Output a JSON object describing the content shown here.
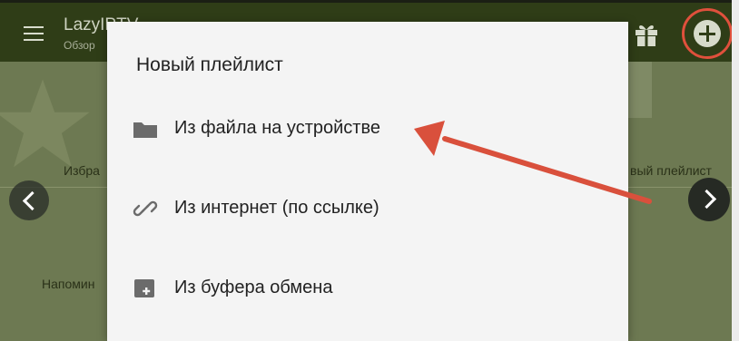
{
  "app_bar": {
    "title": "LazyIPTV",
    "subtitle": "Обзор",
    "add_button_label": "+"
  },
  "background": {
    "tiles": [
      {
        "label": "Избра"
      },
      {
        "label": "Напомин"
      },
      {
        "label": "вый плейлист"
      }
    ]
  },
  "dialog": {
    "title": "Новый плейлист",
    "items": [
      {
        "label": "Из файла на устройстве",
        "icon": "folder-icon"
      },
      {
        "label": "Из интернет (по ссылке)",
        "icon": "link-icon"
      },
      {
        "label": "Из буфера обмена",
        "icon": "clipboard-icon"
      }
    ]
  },
  "colors": {
    "app_bar": "#2f3d17",
    "highlight": "#e0503c",
    "dialog_bg": "#f4f4f4"
  }
}
